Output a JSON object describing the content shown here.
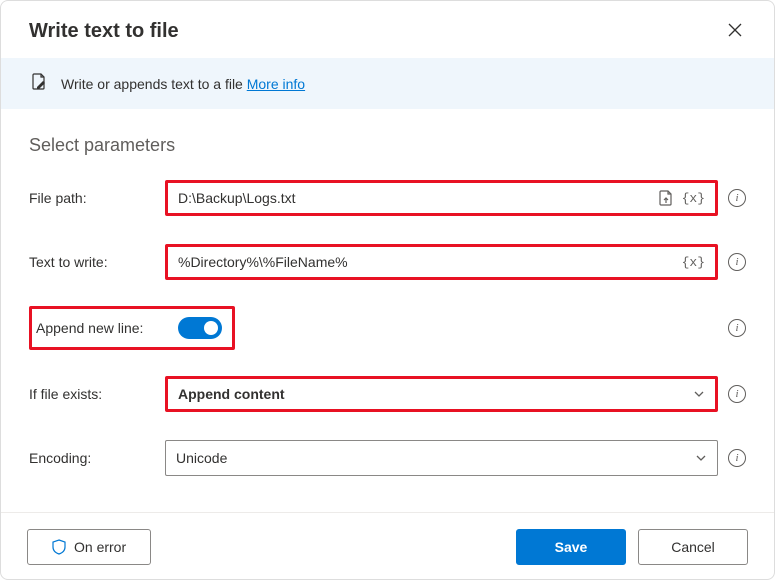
{
  "title": "Write text to file",
  "banner": {
    "text": "Write or appends text to a file ",
    "link": "More info"
  },
  "sectionTitle": "Select parameters",
  "labels": {
    "filePath": "File path:",
    "textToWrite": "Text to write:",
    "appendNewLine": "Append new line:",
    "ifFileExists": "If file exists:",
    "encoding": "Encoding:"
  },
  "values": {
    "filePath": "D:\\Backup\\Logs.txt",
    "textToWrite": "%Directory%\\%FileName%",
    "appendNewLine": true,
    "ifFileExists": "Append content",
    "encoding": "Unicode"
  },
  "tokens": {
    "var": "{x}"
  },
  "buttons": {
    "onError": "On error",
    "save": "Save",
    "cancel": "Cancel"
  }
}
